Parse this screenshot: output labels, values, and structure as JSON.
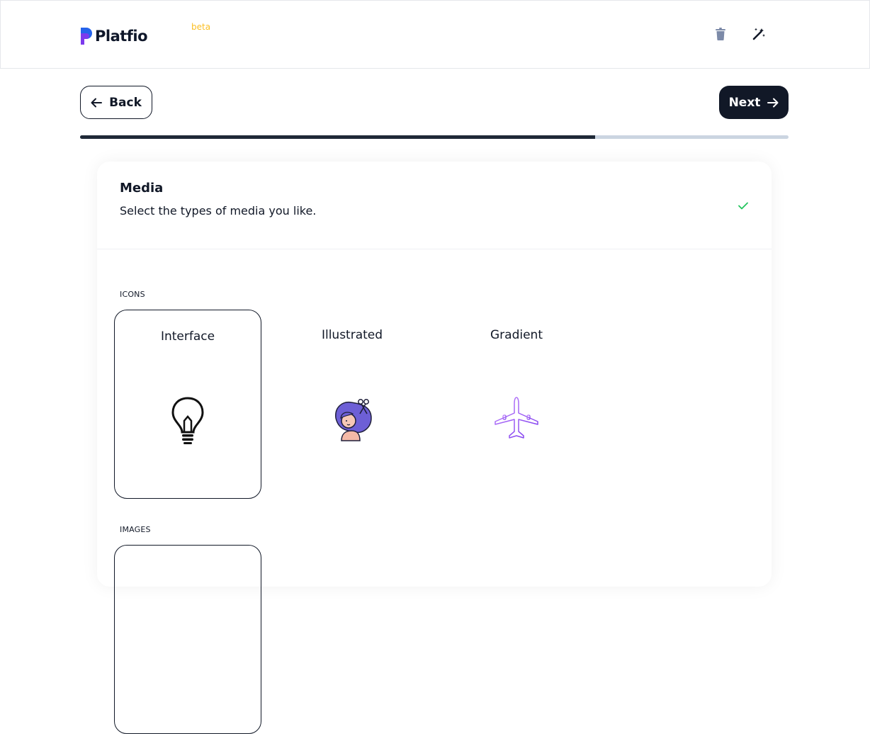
{
  "header": {
    "logo_text": "Platfio",
    "beta_label": "beta",
    "icons": {
      "trash": "trash-icon",
      "magic": "magic-wand-icon"
    },
    "colors": {
      "brand_blue": "#2563eb",
      "brand_purple": "#7c3aed",
      "beta": "#fbbf24"
    }
  },
  "nav": {
    "back_label": "Back",
    "next_label": "Next",
    "progress_fraction": 0.727
  },
  "card": {
    "title": "Media",
    "subtitle": "Select the types of media you like.",
    "status_icon": "check-icon",
    "status_color": "#22c55e",
    "sections": [
      {
        "label": "ICONS",
        "tiles": [
          {
            "label": "Interface",
            "icon": "lightbulb-icon",
            "selected": true
          },
          {
            "label": "Illustrated",
            "icon": "woman-scissors-illustration-icon",
            "selected": false
          },
          {
            "label": "Gradient",
            "icon": "airplane-icon",
            "selected": false
          }
        ]
      },
      {
        "label": "IMAGES",
        "tiles": []
      }
    ]
  }
}
